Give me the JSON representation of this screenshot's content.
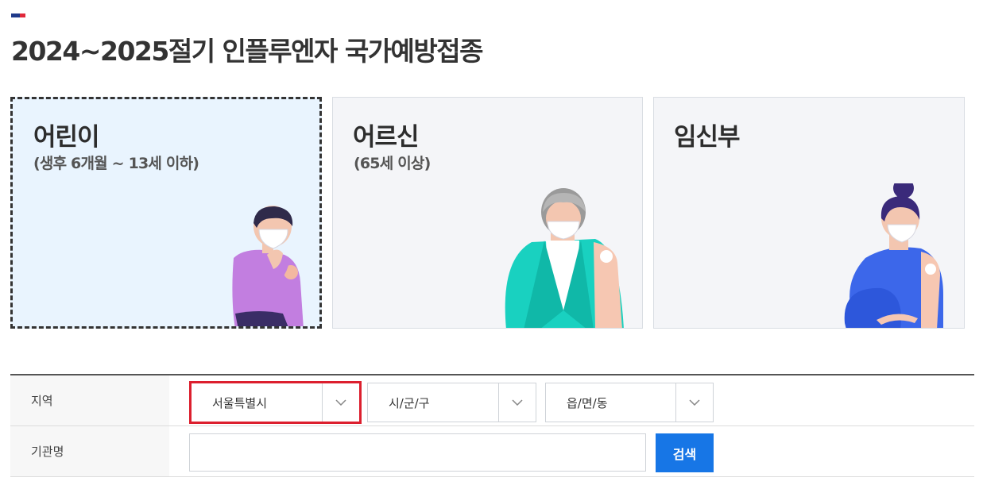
{
  "page": {
    "title": "2024~2025절기 인플루엔자 국가예방접종"
  },
  "targets": [
    {
      "title": "어린이",
      "subtitle": "(생후 6개월 ~ 13세 이하)",
      "selected": true,
      "illustration": "child-vaccination-illustration"
    },
    {
      "title": "어르신",
      "subtitle": "(65세 이상)",
      "selected": false,
      "illustration": "elderly-vaccination-illustration"
    },
    {
      "title": "임신부",
      "subtitle": "",
      "selected": false,
      "illustration": "pregnant-vaccination-illustration"
    }
  ],
  "search": {
    "region_label": "지역",
    "sido_value": "서울특별시",
    "sigungu_value": "시/군/구",
    "eupmyeondong_value": "읍/면/동",
    "org_label": "기관명",
    "org_input_value": "",
    "search_button": "검색"
  },
  "colors": {
    "selected_card_bg": "#e9f4fe",
    "card_bg": "#f4f5f8",
    "highlight_border": "#dc1f2e",
    "search_button_bg": "#1776e6"
  }
}
